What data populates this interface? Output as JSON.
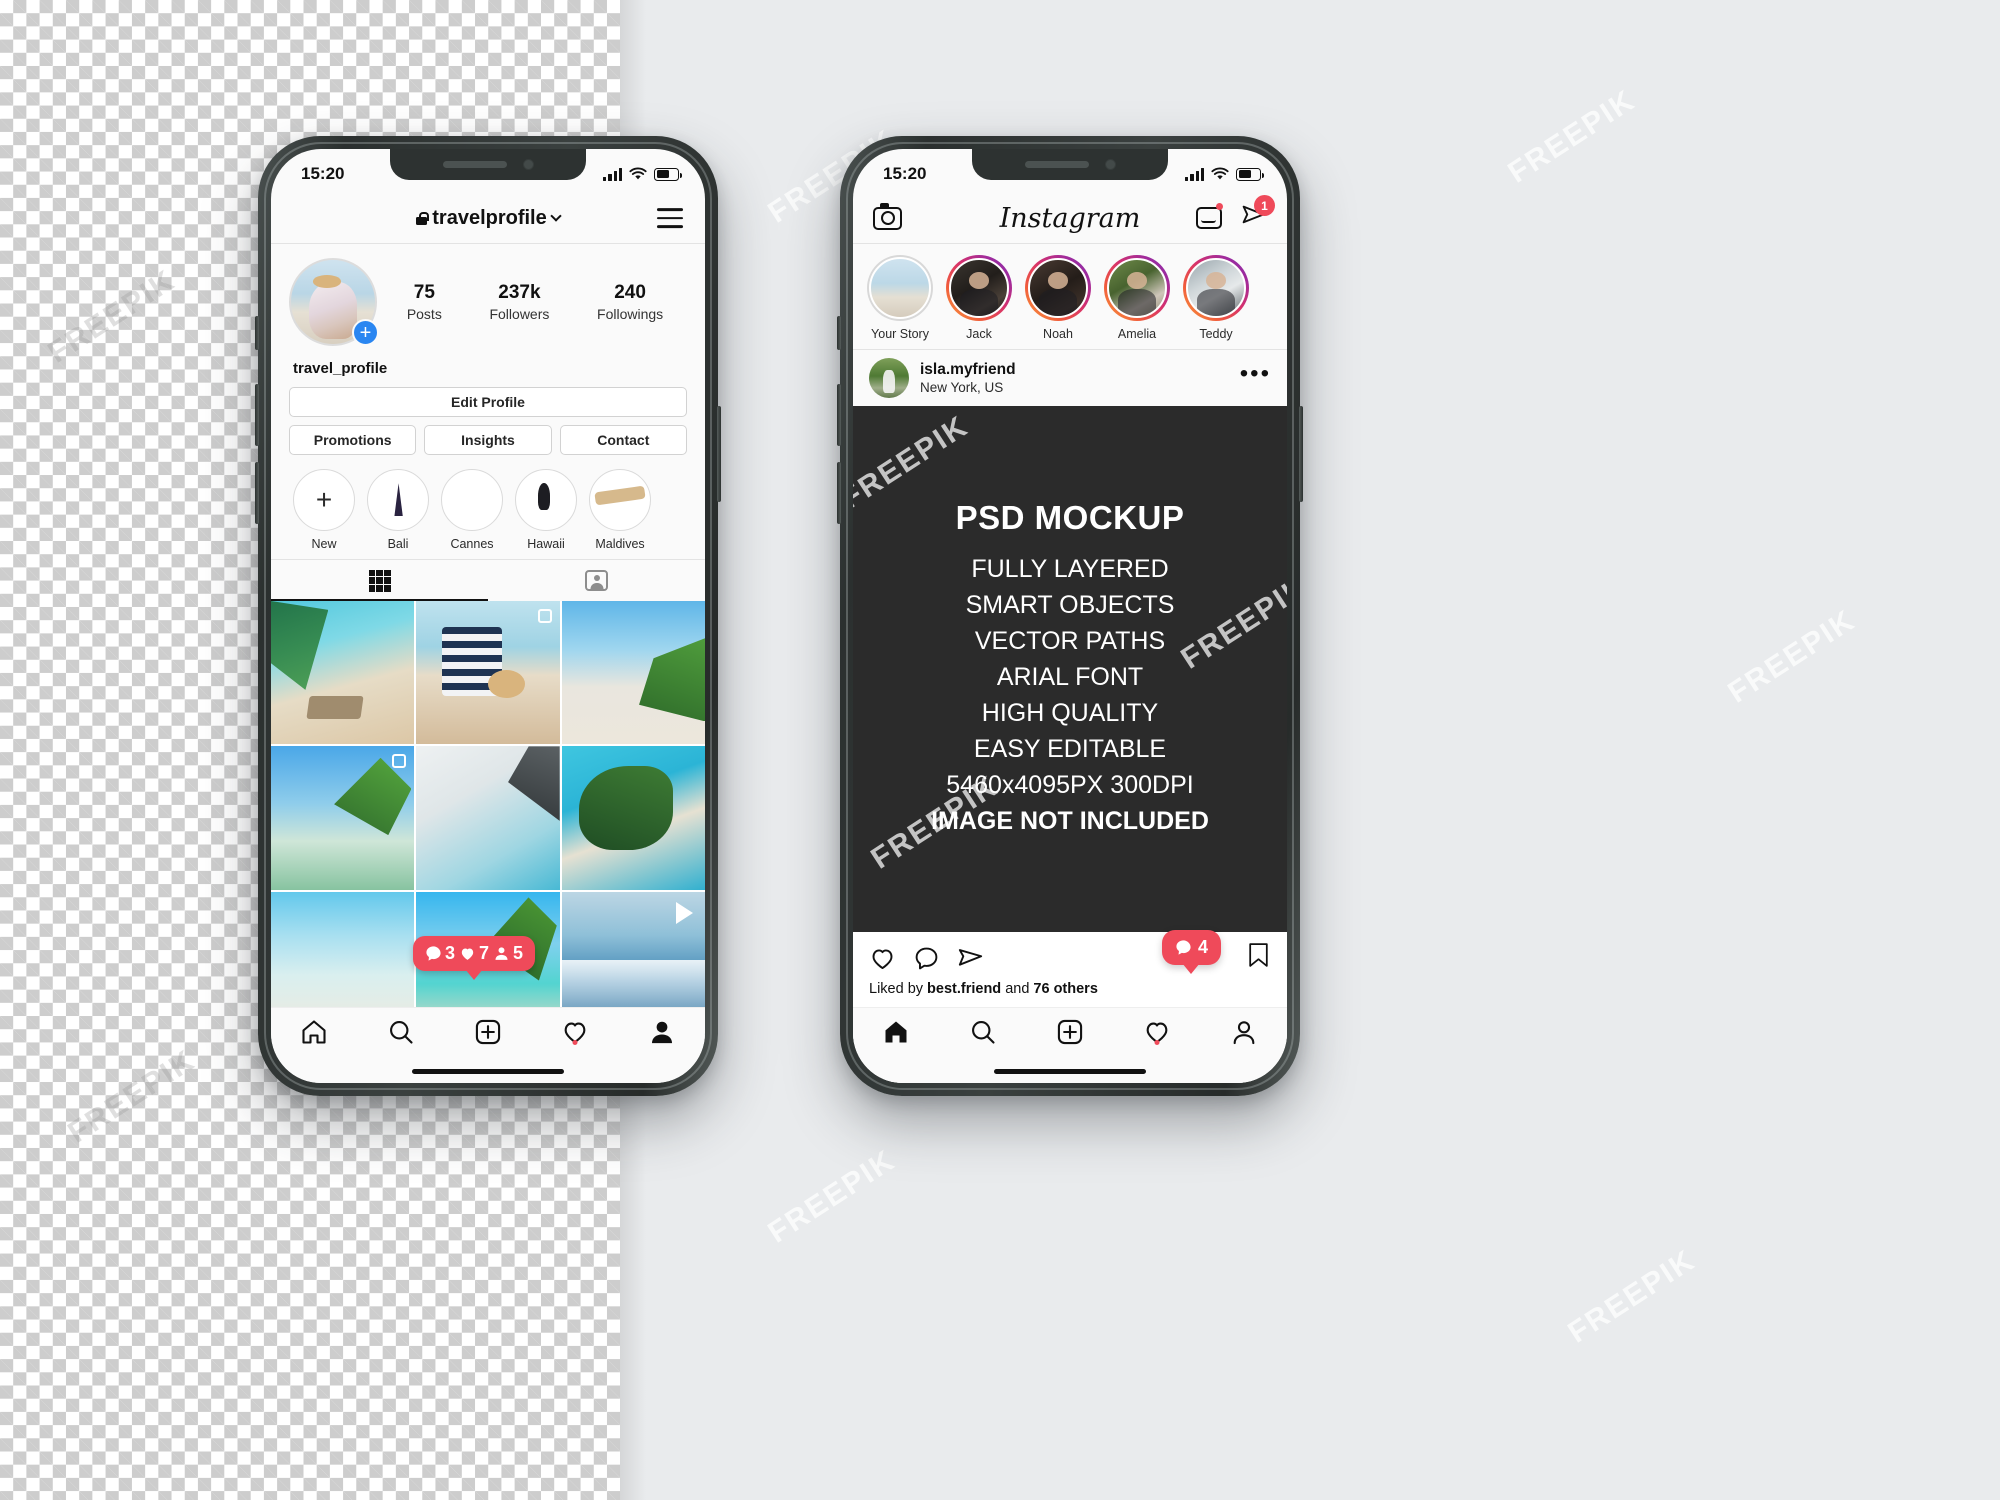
{
  "phone1": {
    "status": {
      "time": "15:20"
    },
    "header": {
      "username": "travelprofile",
      "lock_icon": "lock-icon",
      "chevron": "chevron-down-icon",
      "menu_icon": "hamburger-menu-icon"
    },
    "stats": [
      {
        "number": "75",
        "label": "Posts"
      },
      {
        "number": "237k",
        "label": "Followers"
      },
      {
        "number": "240",
        "label": "Followings"
      }
    ],
    "display_name": "travel_profile",
    "buttons": {
      "edit_profile": "Edit Profile",
      "promotions": "Promotions",
      "insights": "Insights",
      "contact": "Contact"
    },
    "highlights": [
      {
        "label": "New",
        "kind": "add"
      },
      {
        "label": "Bali",
        "kind": "bali"
      },
      {
        "label": "Cannes",
        "kind": "cannes"
      },
      {
        "label": "Hawaii",
        "kind": "hawaii"
      },
      {
        "label": "Maldives",
        "kind": "maldives"
      }
    ],
    "tabs": [
      {
        "name": "grid-tab",
        "active": true
      },
      {
        "name": "tagged-tab",
        "active": false
      }
    ],
    "badge": {
      "comments": "3",
      "likes": "7",
      "follows": "5"
    },
    "nav": [
      "home-icon",
      "search-icon",
      "add-post-icon",
      "activity-icon",
      "profile-icon"
    ]
  },
  "phone2": {
    "status": {
      "time": "15:20"
    },
    "header": {
      "logo": "Instagram",
      "camera_icon": "camera-icon",
      "igtv_icon": "igtv-icon",
      "direct_icon": "direct-message-icon",
      "direct_count": "1"
    },
    "stories": [
      {
        "label": "Your Story",
        "ring": false
      },
      {
        "label": "Jack",
        "ring": true
      },
      {
        "label": "Noah",
        "ring": true
      },
      {
        "label": "Amelia",
        "ring": true
      },
      {
        "label": "Teddy",
        "ring": true
      }
    ],
    "post": {
      "username": "isla.myfriend",
      "location": "New York, US",
      "more_icon": "more-options-icon",
      "title": "PSD MOCKUP",
      "lines": [
        {
          "text": "FULLY LAYERED",
          "bold": false
        },
        {
          "text": "SMART OBJECTS",
          "bold": false
        },
        {
          "text": "VECTOR PATHS",
          "bold": false
        },
        {
          "text": "ARIAL FONT",
          "bold": false
        },
        {
          "text": "HIGH QUALITY",
          "bold": false
        },
        {
          "text": "EASY EDITABLE",
          "bold": false
        },
        {
          "text": "5460x4095PX 300DPI",
          "bold": false
        },
        {
          "text": "IMAGE NOT INCLUDED",
          "bold": true
        }
      ],
      "likes_prefix": "Liked by ",
      "likes_user": "best.friend",
      "likes_mid": " and ",
      "likes_count": "76 others",
      "comment_badge": "4"
    },
    "nav": [
      "home-icon",
      "search-icon",
      "add-post-icon",
      "activity-icon",
      "profile-icon"
    ]
  },
  "watermarks": [
    "FREEPIK",
    "FREEPIK",
    "FREEPIK",
    "FREEPIK",
    "FREEPIK",
    "FREEPIK",
    "FREEPIK",
    "FREEPIK"
  ],
  "colors": {
    "accent_red": "#ef4a5a",
    "accent_blue": "#2a86f1",
    "post_bg": "#2b2b2b",
    "canvas": "#e9ebed"
  }
}
